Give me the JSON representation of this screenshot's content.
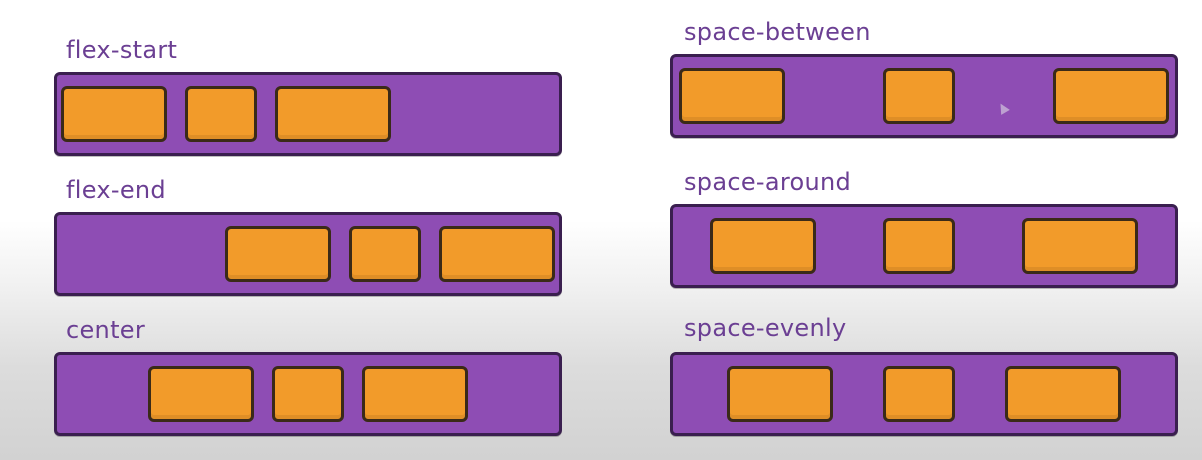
{
  "panels": [
    {
      "label": "flex-start"
    },
    {
      "label": "flex-end"
    },
    {
      "label": "center"
    },
    {
      "label": "space-between"
    },
    {
      "label": "space-around"
    },
    {
      "label": "space-evenly"
    }
  ],
  "colors": {
    "container": "#8e4db4",
    "container_border": "#3a1f4f",
    "item": "#f29b2a",
    "item_border": "#3a2a18",
    "label": "#6b3f93"
  }
}
